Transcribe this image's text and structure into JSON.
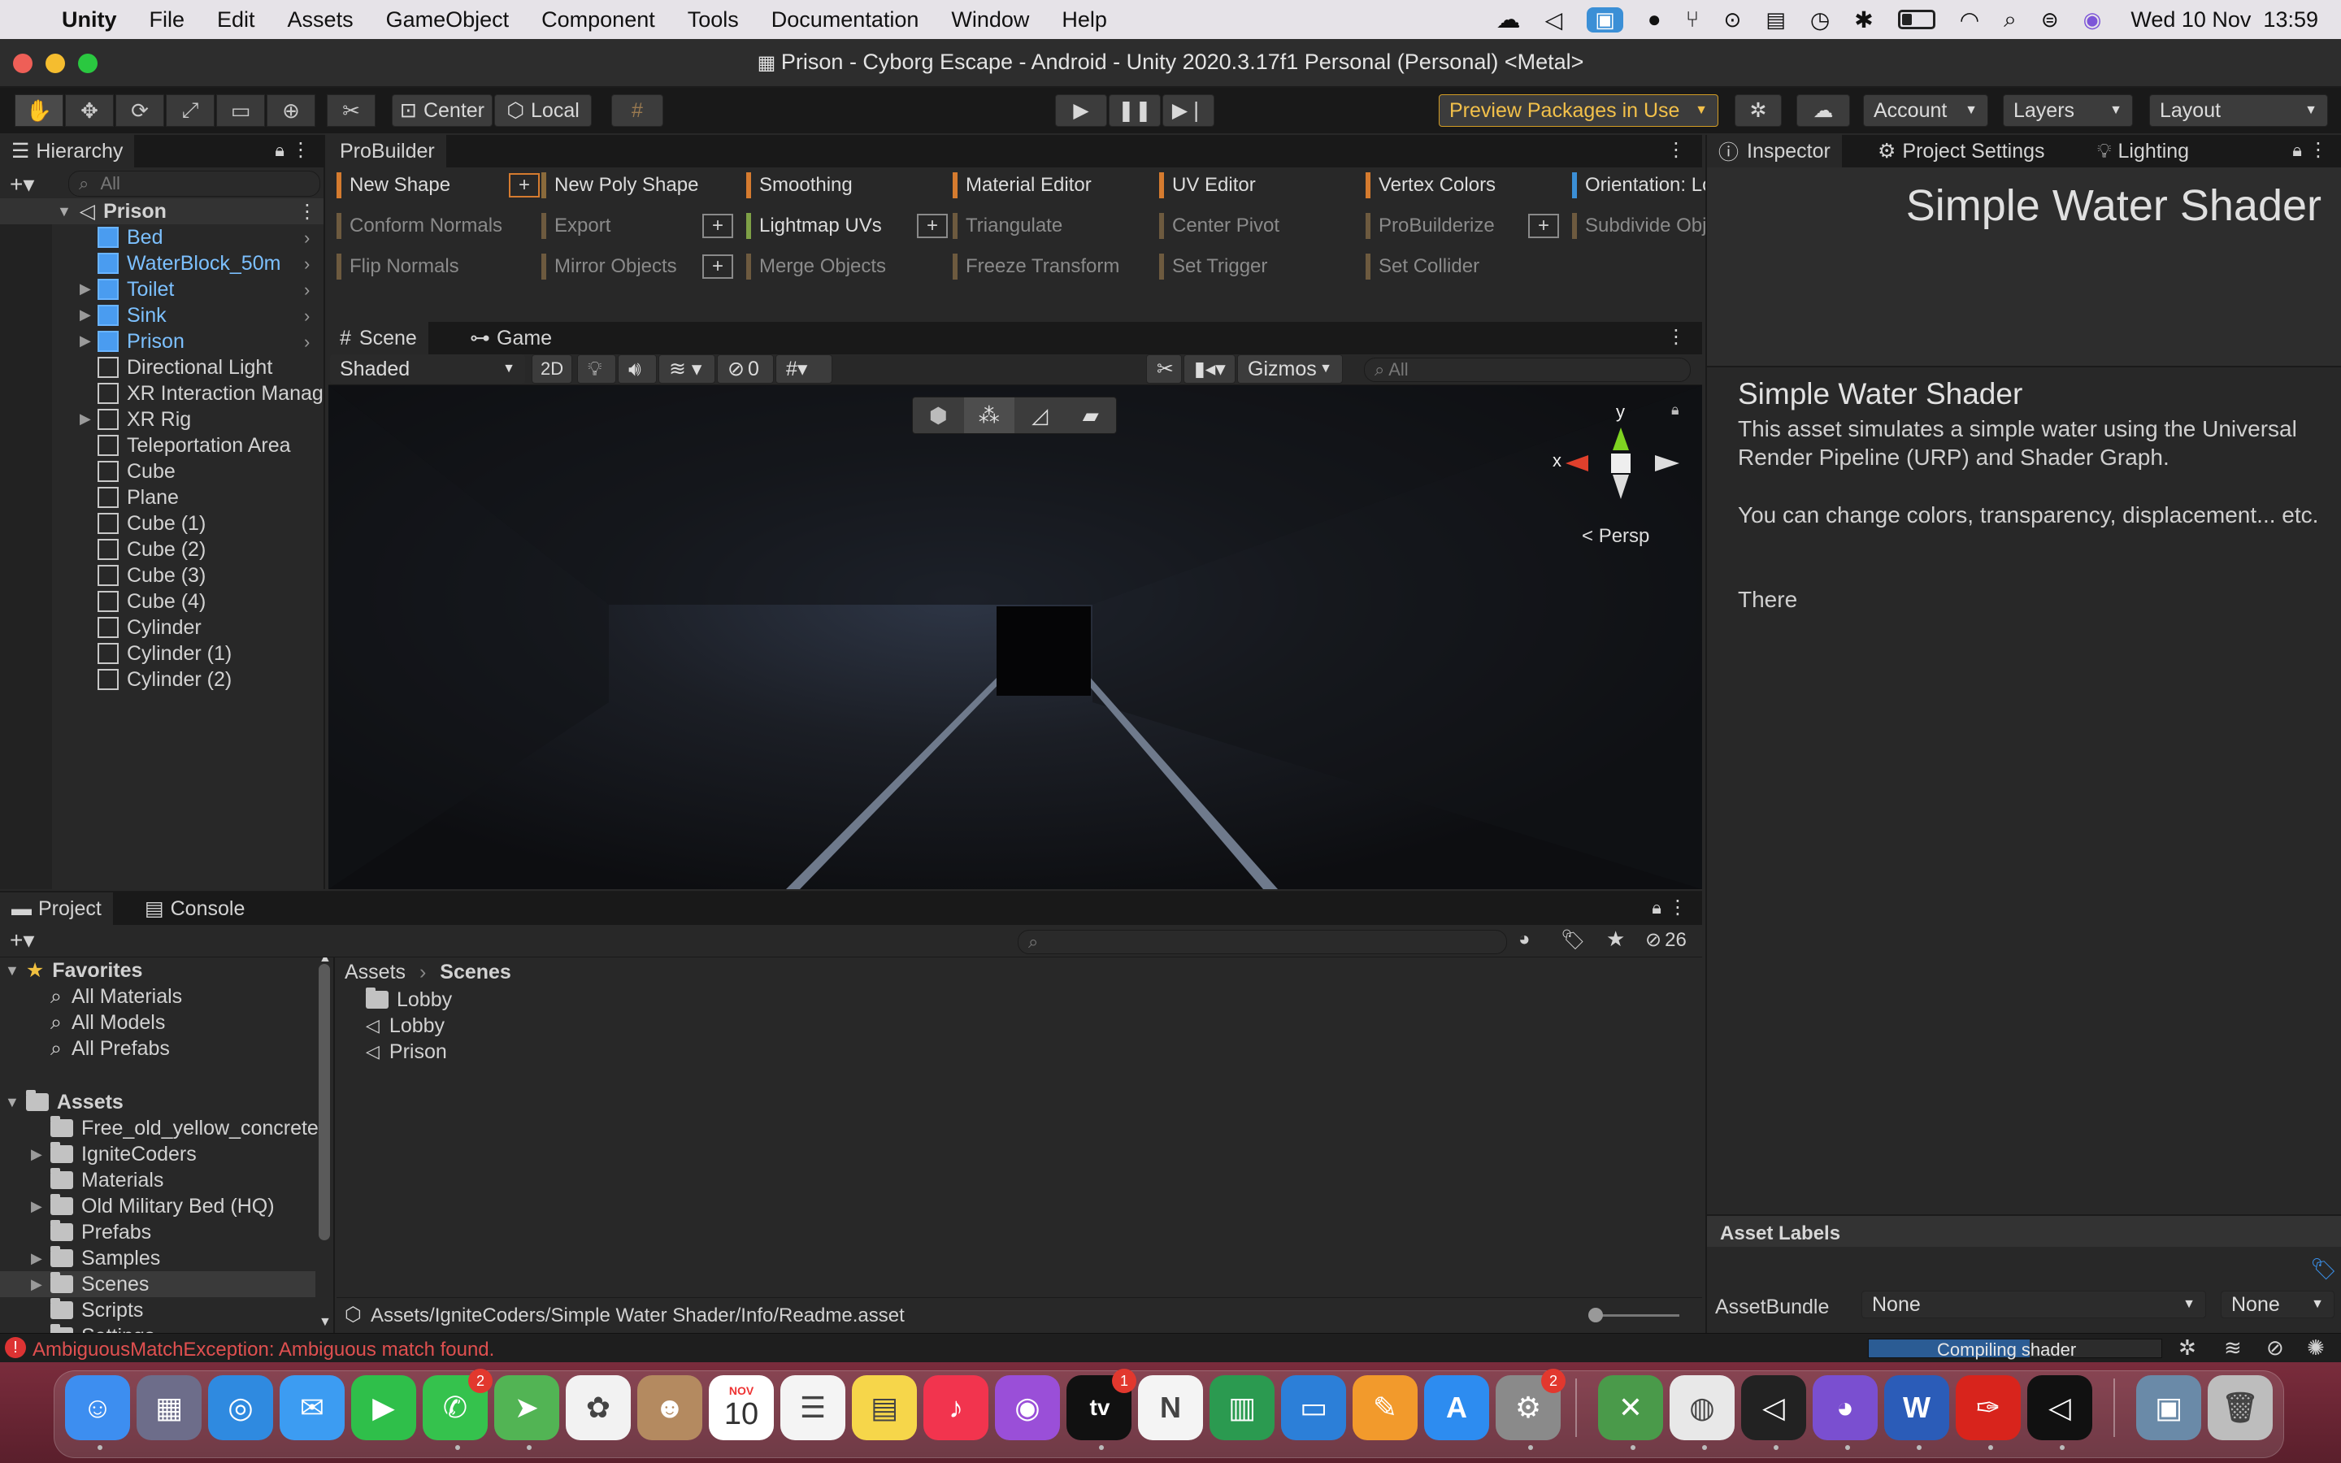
{
  "menubar": {
    "app": "Unity",
    "items": [
      "File",
      "Edit",
      "Assets",
      "GameObject",
      "Component",
      "Tools",
      "Documentation",
      "Window",
      "Help"
    ],
    "clock": "Wed 10 Nov  13:59"
  },
  "window": {
    "title": "Prison - Cyborg Escape - Android - Unity 2020.3.17f1 Personal (Personal) <Metal>"
  },
  "toolbar": {
    "center": "Center",
    "local": "Local",
    "preview_packages": "Preview Packages in Use",
    "account": "Account",
    "layers": "Layers",
    "layout": "Layout"
  },
  "hierarchy": {
    "tab": "Hierarchy",
    "search": "All",
    "scene": "Prison",
    "items": [
      "Bed",
      "WaterBlock_50m",
      "Toilet",
      "Sink",
      "Prison",
      "Directional Light",
      "XR Interaction Manag",
      "XR Rig",
      "Teleportation Area",
      "Cube",
      "Plane",
      "Cube (1)",
      "Cube (2)",
      "Cube (3)",
      "Cube (4)",
      "Cylinder",
      "Cylinder (1)",
      "Cylinder (2)"
    ]
  },
  "probuilder": {
    "tab": "ProBuilder",
    "col1": [
      "New Shape",
      "Conform Normals",
      "Flip Normals"
    ],
    "col2": [
      "New Poly Shape",
      "Export",
      "Mirror Objects"
    ],
    "col3": [
      "Smoothing",
      "Lightmap UVs",
      "Merge Objects"
    ],
    "col4": [
      "Material Editor",
      "Triangulate",
      "Freeze Transform"
    ],
    "col5": [
      "UV Editor",
      "Center Pivot",
      "Set Trigger"
    ],
    "col6": [
      "Vertex Colors",
      "ProBuilderize",
      "Set Collider"
    ],
    "col7": [
      "Orientation: Lo",
      "Subdivide Obj"
    ],
    "plus": "+"
  },
  "scene": {
    "tab_scene": "Scene",
    "tab_game": "Game",
    "shading": "Shaded",
    "mode2d": "2D",
    "hidden_count": "0",
    "gizmos": "Gizmos",
    "search": "All",
    "persp": "Persp",
    "axis_x": "x",
    "axis_y": "y"
  },
  "inspector": {
    "tab_inspector": "Inspector",
    "tab_project_settings": "Project Settings",
    "tab_lighting": "Lighting",
    "header": "Simple Water Shader",
    "title": "Simple Water Shader",
    "body1": "This asset simulates a simple water using the Universal Render Pipeline (URP) and Shader Graph.",
    "body2": "You can change colors, transparency, displacement... etc.",
    "body3": "There",
    "asset_labels": "Asset Labels",
    "assetbundle_label": "AssetBundle",
    "assetbundle_value": "None",
    "variant_value": "None"
  },
  "project": {
    "tab_project": "Project",
    "tab_console": "Console",
    "visible_count": "26",
    "favorites": "Favorites",
    "fav_items": [
      "All Materials",
      "All Models",
      "All Prefabs"
    ],
    "assets": "Assets",
    "asset_folders": [
      "Free_old_yellow_concrete",
      "IgniteCoders",
      "Materials",
      "Old Military Bed (HQ)",
      "Prefabs",
      "Samples",
      "Scenes",
      "Scripts",
      "Settings"
    ],
    "breadcrumb_root": "Assets",
    "breadcrumb_current": "Scenes",
    "files": [
      "Lobby",
      "Lobby",
      "Prison"
    ],
    "path": "Assets/IgniteCoders/Simple Water Shader/Info/Readme.asset"
  },
  "statusbar": {
    "error": "AmbiguousMatchException: Ambiguous match found.",
    "progress_label": "Compiling shader",
    "progress": 0.55
  },
  "dock": {
    "calendar_month": "NOV",
    "calendar_day": "10",
    "badges": {
      "messages": "2",
      "tv": "1",
      "settings": "2"
    },
    "tv_label": "tv"
  }
}
